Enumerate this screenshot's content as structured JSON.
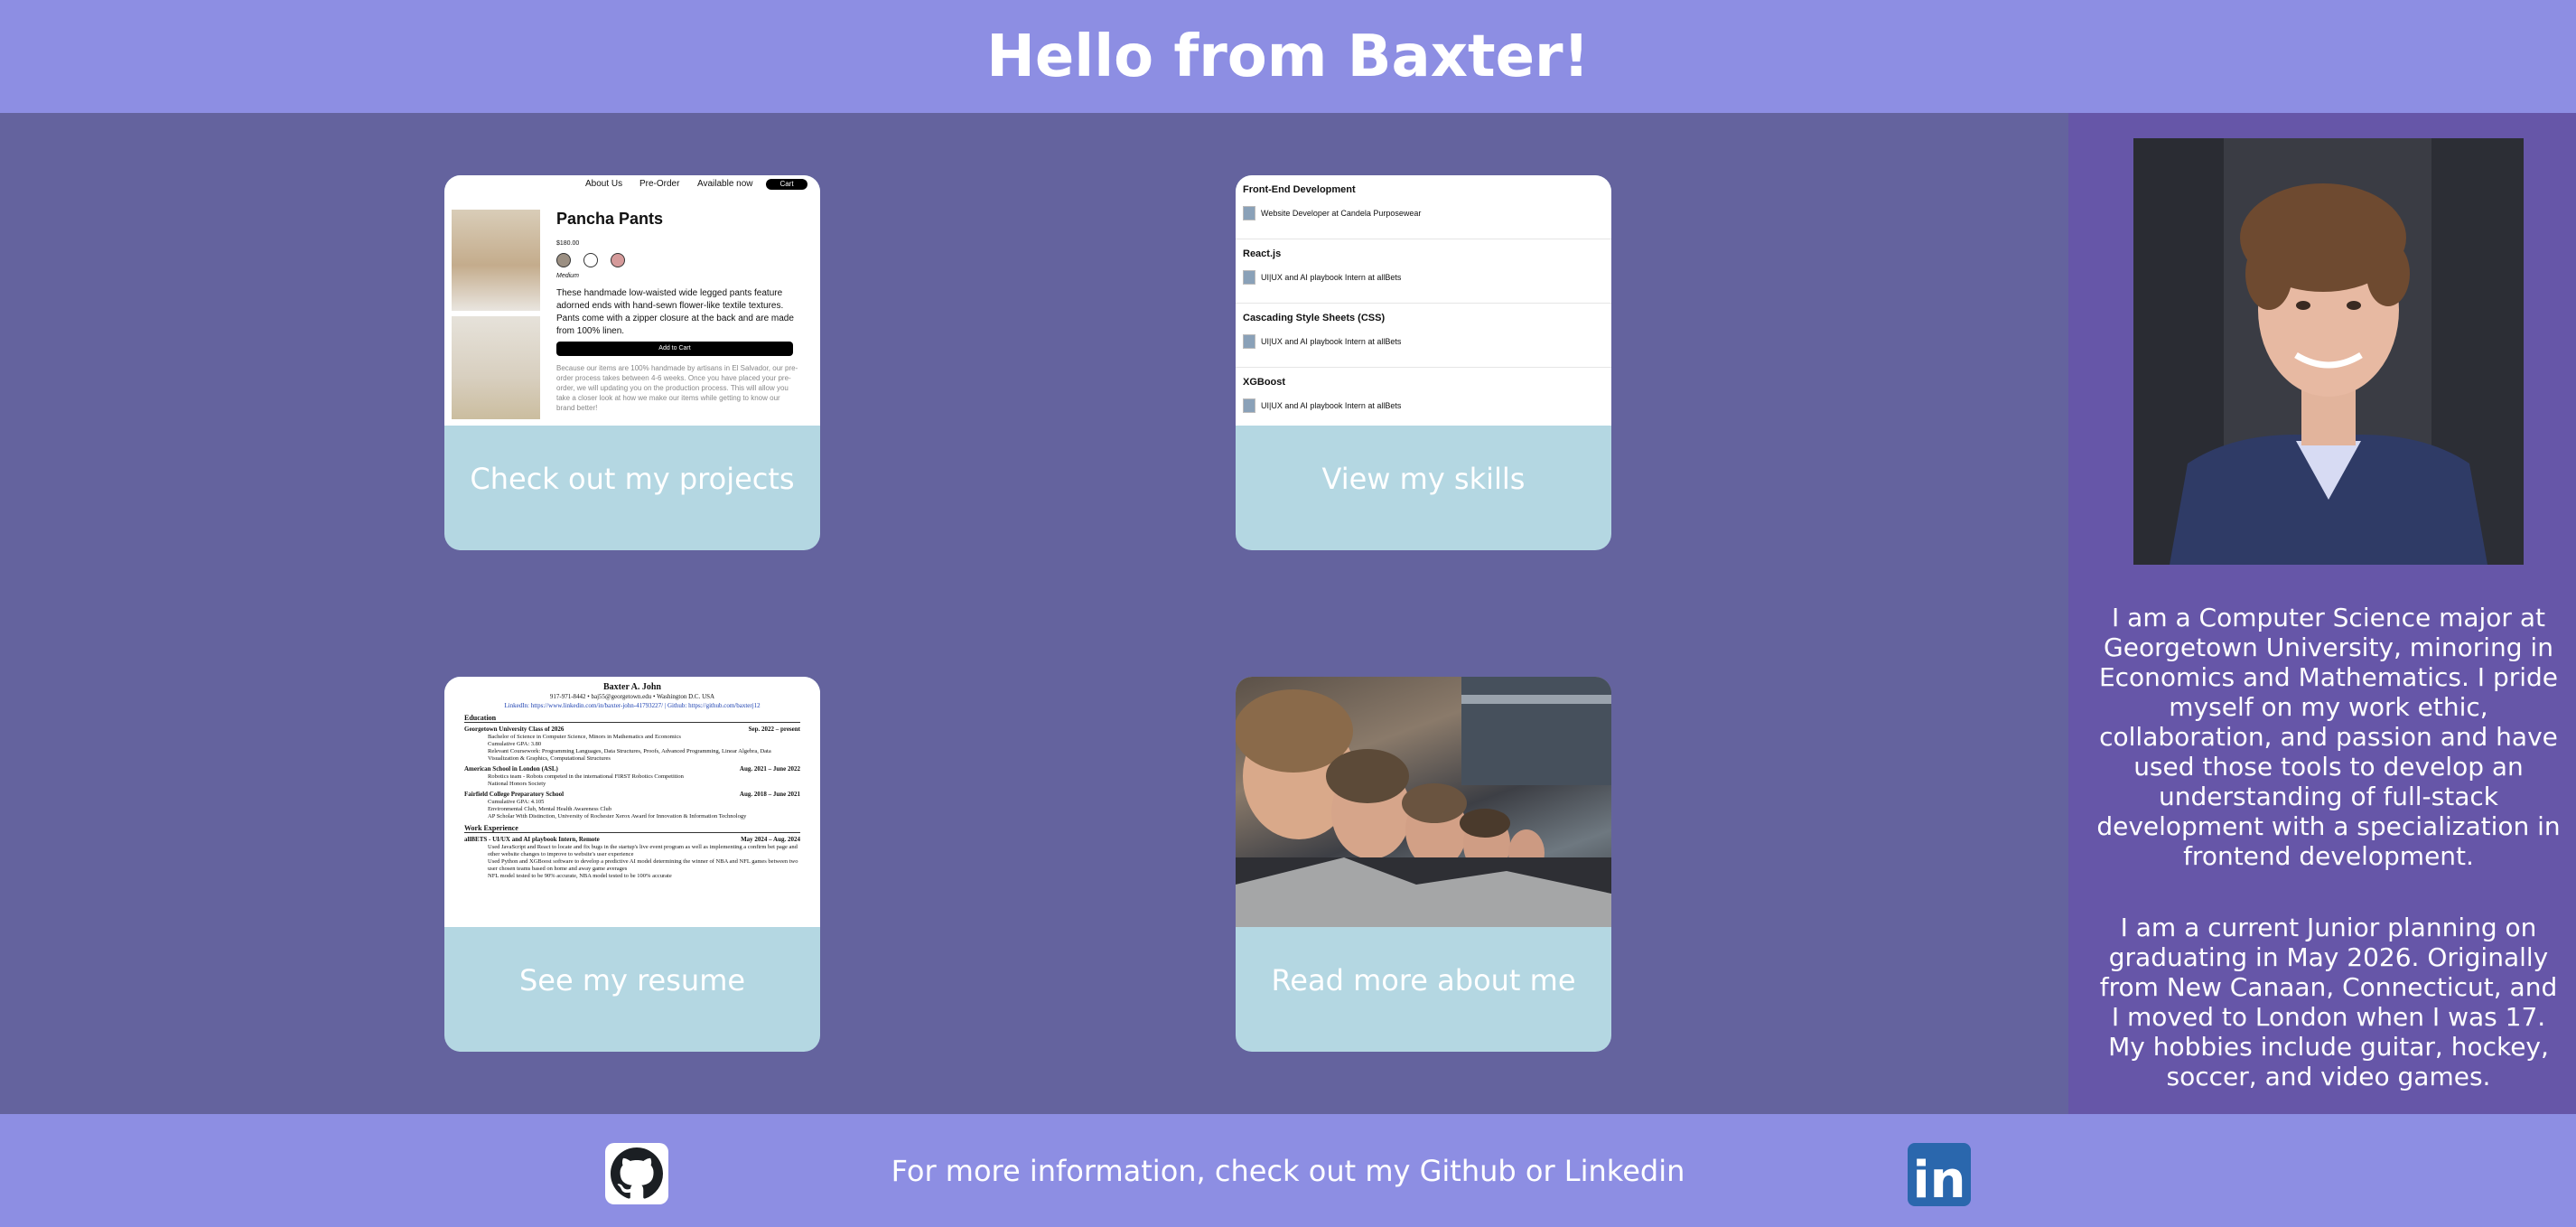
{
  "header": {
    "title": "Hello from Baxter!"
  },
  "cards": [
    {
      "label": "Check out my projects"
    },
    {
      "label": "View my skills"
    },
    {
      "label": "See my resume"
    },
    {
      "label": "Read more about me"
    }
  ],
  "projects_preview": {
    "nav": [
      "About Us",
      "Pre-Order",
      "Available now"
    ],
    "cart": "Cart",
    "product_title": "Pancha Pants",
    "price": "$180.00",
    "size": "Medium",
    "description": "These handmade low-waisted wide legged pants feature adorned ends with hand-sewn flower-like textile textures. Pants come with a zipper closure at the back and are made from 100% linen.",
    "add_to_cart": "Add to Cart",
    "footnote": "Because our items are 100% handmade by artisans in El Salvador, our pre-order process takes between 4-6 weeks. Once you have placed your pre-order, we will updating you on the production process. This will allow you take a closer look at how we make our items while getting to know our brand better!"
  },
  "skills_preview": [
    {
      "name": "Front-End Development",
      "item": "Website Developer at Candela Purposewear"
    },
    {
      "name": "React.js",
      "item": "UI|UX and AI playbook Intern at allBets"
    },
    {
      "name": "Cascading Style Sheets (CSS)",
      "item": "UI|UX and AI playbook Intern at allBets"
    },
    {
      "name": "XGBoost",
      "item": "UI|UX and AI playbook Intern at allBets"
    }
  ],
  "resume_preview": {
    "name": "Baxter A. John",
    "contact": "917-971-8442 • baj55@georgetown.edu • Washington D.C. USA",
    "links": "LinkedIn: https://www.linkedin.com/in/baxter-john-41793227/ | Github: https://github.com/baxterj12",
    "education_heading": "Education",
    "entries": [
      {
        "school": "Georgetown University Class of 2026",
        "dates": "Sep. 2022 – present",
        "bullets": [
          "Bachelor of Science in Computer Science, Minors in Mathematics and Economics",
          "Cumulative GPA: 3.80",
          "Relevant Coursework: Programming Languages, Data Structures, Proofs, Advanced Programming, Linear Algebra, Data Visualization & Graphics, Computational Structures"
        ]
      },
      {
        "school": "American School in London (ASL)",
        "dates": "Aug. 2021 – June 2022",
        "bullets": [
          "Robotics team - Robots competed in the international FIRST Robotics Competition",
          "National Honors Society"
        ]
      },
      {
        "school": "Fairfield College Preparatory School",
        "dates": "Aug. 2018 – June 2021",
        "bullets": [
          "Cumulative GPA: 4.105",
          "Environmental Club, Mental Health Awareness Club",
          "AP Scholar With Distinction, University of Rochester Xerox Award for Innovation & Information Technology"
        ]
      }
    ],
    "work_heading": "Work Experience",
    "work": {
      "title": "allBETS - UI/UX and AI playbook Intern, Remote",
      "dates": "May 2024 – Aug. 2024",
      "bullets": [
        "Used JavaScript and React to locate and fix bugs in the startup's live event program as well as implementing a confirm bet page and other website changes to improve to website's user experience",
        "Used Python and XGBoost software to develop a predictive AI model determining the winner of NBA and NFL games between two user chosen teams based on home and away game averages",
        "NFL model tested to be 90% accurate, NBA model tested to be 100% accurate"
      ]
    }
  },
  "about": {
    "paragraph1": "I am a Computer Science major at Georgetown University, minoring in Economics and Mathematics. I pride myself on my work ethic, collaboration, and passion and have used those tools to develop an understanding of full-stack development with a specialization in frontend development.",
    "paragraph2": "I am a current Junior planning on graduating in May 2026. Originally from New Canaan, Connecticut, and I moved to London when I was 17. My hobbies include guitar, hockey, soccer, and video games."
  },
  "footer": {
    "text": "For more information, check out my Github or Linkedin",
    "linkedin_glyph": "in"
  },
  "colors": {
    "header_bg": "#8d8ee3",
    "main_bg": "#64639e",
    "sidebar_bg": "#6656a8",
    "card_label_bg": "#b4d7e2",
    "linkedin_blue": "#2a67ad"
  },
  "icons": {
    "github": "github-icon",
    "linkedin": "linkedin-icon"
  }
}
